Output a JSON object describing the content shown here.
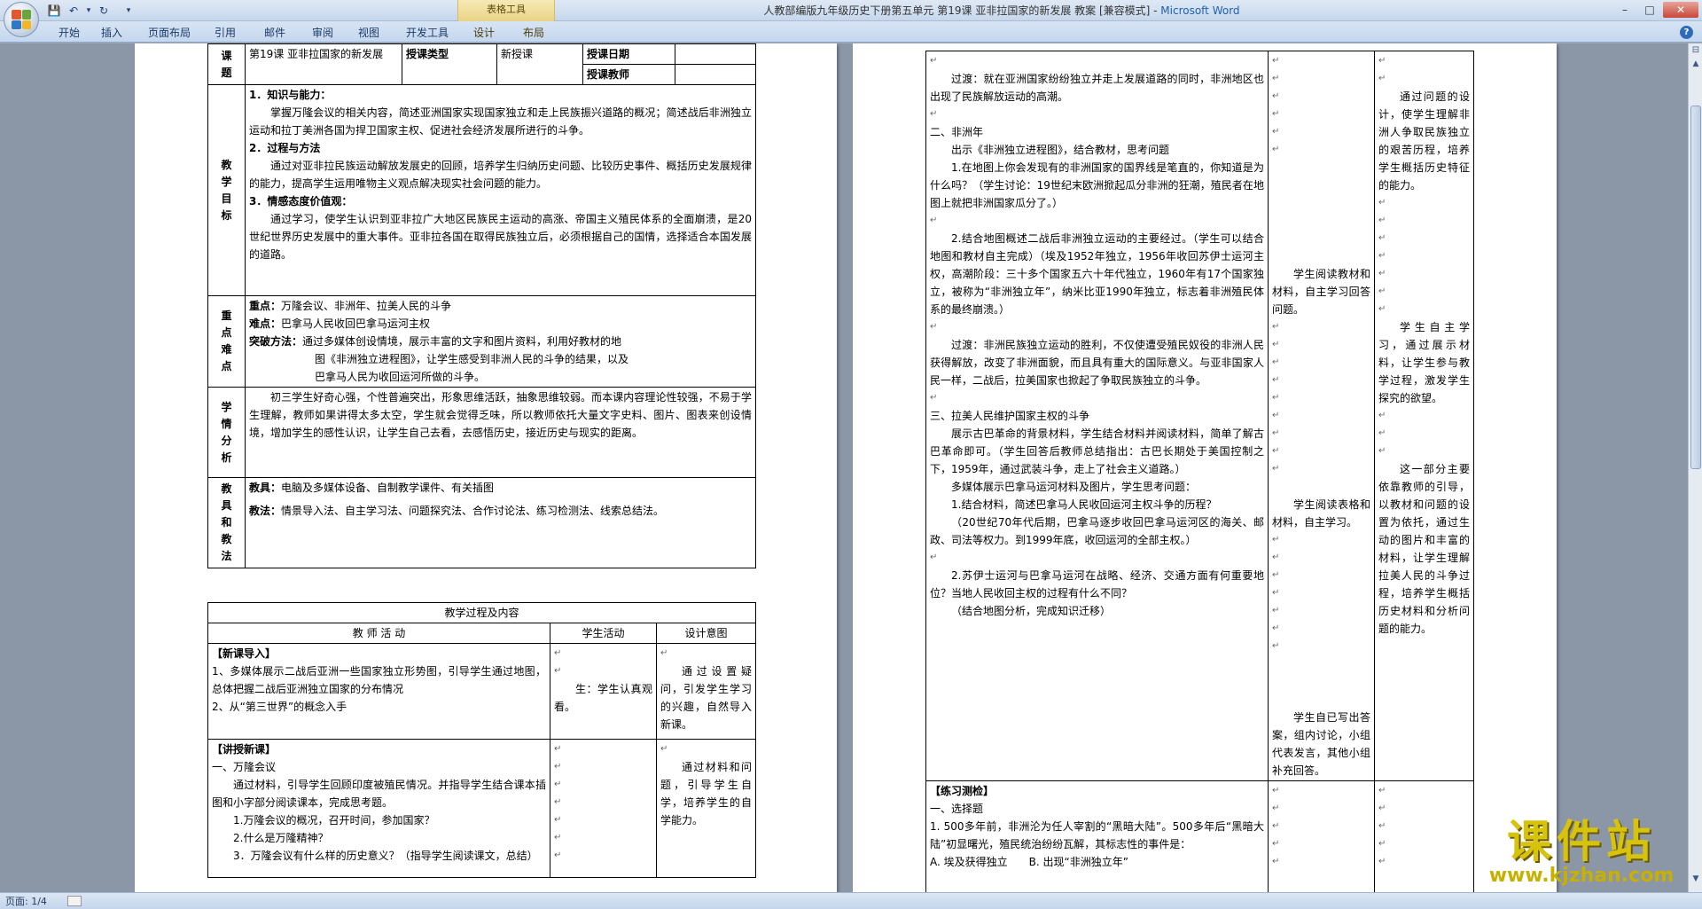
{
  "window": {
    "title": "人教部编版九年级历史下册第五单元 第19课 亚非拉国家的新发展 教案 [兼容模式] - ",
    "app": "Microsoft Word",
    "table_tools": "表格工具",
    "minimize": "–",
    "maximize": "□",
    "close": "✕"
  },
  "qat": {
    "save": "💾",
    "undo": "↶",
    "undo_drop": "▾",
    "redo": "↻",
    "customize": "▾"
  },
  "ribbon": {
    "tabs": [
      "开始",
      "插入",
      "页面布局",
      "引用",
      "邮件",
      "审阅",
      "视图",
      "开发工具",
      "设计",
      "布局"
    ],
    "help": "?"
  },
  "page1": {
    "lesson_label": "课题",
    "lesson_title": "第19课 亚非拉国家的新发展",
    "type_label": "授课类型",
    "type_value": "新授课",
    "date_label": "授课日期",
    "teacher_label": "授课教师",
    "goals_label": "教学目标",
    "goal1_title": "1．知识与能力：",
    "goal1_text": "掌握万隆会议的相关内容，简述亚洲国家实现国家独立和走上民族振兴道路的概况；简述战后非洲独立运动和拉丁美洲各国为捍卫国家主权、促进社会经济发展所进行的斗争。",
    "goal2_title": "2．过程与方法",
    "goal2_text": "通过对亚非拉民族运动解放发展史的回顾，培养学生归纳历史问题、比较历史事件、概括历史发展规律的能力，提高学生运用唯物主义观点解决现实社会问题的能力。",
    "goal3_title": "3．情感态度价值观：",
    "goal3_text": "通过学习，使学生认识到亚非拉广大地区民族民主运动的高涨、帝国主义殖民体系的全面崩溃，是20世纪世界历史发展中的重大事件。亚非拉各国在取得民族独立后，必须根据自己的国情，选择适合本国发展的道路。",
    "key_label": "重点难点",
    "key_title": "重点：",
    "key_text": "万隆会议、非洲年、拉美人民的斗争",
    "hard_title": "难点：",
    "hard_text": "巴拿马人民收回巴拿马运河主权",
    "method_title": "突破方法：",
    "method_text1": "通过多媒体创设情境，展示丰富的文字和图片资料，利用好教材的地",
    "method_text2": "图《非洲独立进程图》，让学生感受到非洲人民的斗争的结果，以及",
    "method_text3": "巴拿马人民为收回运河所做的斗争。",
    "student_label": "学情分析",
    "student_text": "初三学生好奇心强，个性普遍突出，形象思维活跃，抽象思维较弱。而本课内容理论性较强，不易于学生理解，教师如果讲得太多太空，学生就会觉得乏味，所以教师依托大量文字史料、图片、图表来创设情境，增加学生的感性认识，让学生自己去看，去感悟历史，接近历史与现实的距离。",
    "tools_label": "教具和教法",
    "tools_title": "教具：",
    "tools_text": "电脑及多媒体设备、自制教学课件、有关插图",
    "method2_title": "教法：",
    "method2_text": "情景导入法、自主学习法、问题探究法、合作讨论法、练习检测法、线索总结法。",
    "process_header": "教学过程及内容",
    "col_teacher": "教 师 活 动",
    "col_student": "学生活动",
    "col_design": "设计意图",
    "intro_title": "【新课导入】",
    "intro_1": "1、多媒体展示二战后亚洲一些国家独立形势图，引导学生通过地图，总体把握二战后亚洲独立国家的分布情况",
    "intro_2": "2、从“第三世界”的概念入手",
    "intro_student": "生：学生认真观看。",
    "intro_design": "通过设置疑问，引发学生学习的兴趣，自然导入新课。",
    "new_title": "【讲授新课】",
    "new_1": "一、万隆会议",
    "new_2": "通过材料，引导学生回顾印度被殖民情况。并指导学生结合课本插图和小字部分阅读课本，完成思考题。",
    "new_q1": "1.万隆会议的概况，召开时间，参加国家？",
    "new_q2": "2.什么是万隆精神？",
    "new_q3": "3．万隆会议有什么样的历史意义？（指导学生阅读课文，总结）",
    "new_design": "通过材料和问题，引导学生自学，培养学生的自学能力。"
  },
  "page2": {
    "t1": "过渡：就在亚洲国家纷纷独立并走上发展道路的同时，非洲地区也出现了民族解放运动的高潮。",
    "t2": "二、非洲年",
    "t3": "出示《非洲独立进程图》，结合教材，思考问题",
    "t4": "1.在地图上你会发现有的非洲国家的国界线是笔直的，你知道是为什么吗？（学生讨论：19世纪末欧洲掀起瓜分非洲的狂潮，殖民者在地图上就把非洲国家瓜分了。）",
    "t5": "2.结合地图概述二战后非洲独立运动的主要经过。（学生可以结合地图和教材自主完成）（埃及1952年独立，1956年收回苏伊士运河主权，高潮阶段：三十多个国家五六十年代独立，1960年有17个国家独立，被称为“非洲独立年”，纳米比亚1990年独立，标志着非洲殖民体系的最终崩溃。）",
    "t6": "过渡：非洲民族独立运动的胜利，不仅使遭受殖民奴役的非洲人民获得解放，改变了非洲面貌，而且具有重大的国际意义。与亚非国家人民一样，二战后，拉美国家也掀起了争取民族独立的斗争。",
    "t7": "三、拉美人民维护国家主权的斗争",
    "t8": "展示古巴革命的背景材料，学生结合材料并阅读材料，简单了解古巴革命即可。（学生回答后教师总结指出：古巴长期处于美国控制之下，1959年，通过武装斗争，走上了社会主义道路。）",
    "t9": "多媒体展示巴拿马运河材料及图片，学生思考问题：",
    "t10": "1.结合材料，简述巴拿马人民收回运河主权斗争的历程？",
    "t11": "（20世纪70年代后期，巴拿马逐步收回巴拿马运河区的海关、邮政、司法等权力。到1999年底，收回运河的全部主权。）",
    "t12": "2.苏伊士运河与巴拿马运河在战略、经济、交通方面有何重要地位？当地人民收回主权的过程有什么不同？",
    "t13": "（结合地图分析，完成知识迁移）",
    "s1": "学生阅读教材和材料，自主学习回答问题。",
    "s2": "学生阅读表格和材料，自主学习。",
    "s3": "学生自已写出答案，组内讨论，小组代表发言，其他小组补充回答。",
    "d1": "通过问题的设计，使学生理解非洲人争取民族独立的艰苦历程，培养学生概括历史特征的能力。",
    "d2": "学生自主学习，通过展示材料，让学生参与教学过程，激发学生探究的欲望。",
    "d3": "这一部分主要依靠教师的引导，以教材和问题的设置为依托，通过生动的图片和丰富的材料，让学生理解拉美人民的斗争过程，培养学生概括历史材料和分析问题的能力。",
    "ex_title": "【练习测检】",
    "ex_1": "一、选择题",
    "ex_2": "1. 500多年前，非洲沦为任人宰割的“黑暗大陆”。500多年后“黑暗大陆”初显曙光，殖民统治纷纷瓦解，其标志性的事件是：",
    "ex_opt": "A. 埃及获得独立　　B. 出现“非洲独立年”"
  },
  "status": {
    "page": "页面: 1/4"
  },
  "watermark": {
    "logo": "课件站",
    "url": "www.kjzhan.com"
  },
  "colors": {
    "ribbon": "#c5d7ee",
    "page_bg": "#8b97a7",
    "accent": "#1f5fb0",
    "watermark": "#d8c30c"
  }
}
